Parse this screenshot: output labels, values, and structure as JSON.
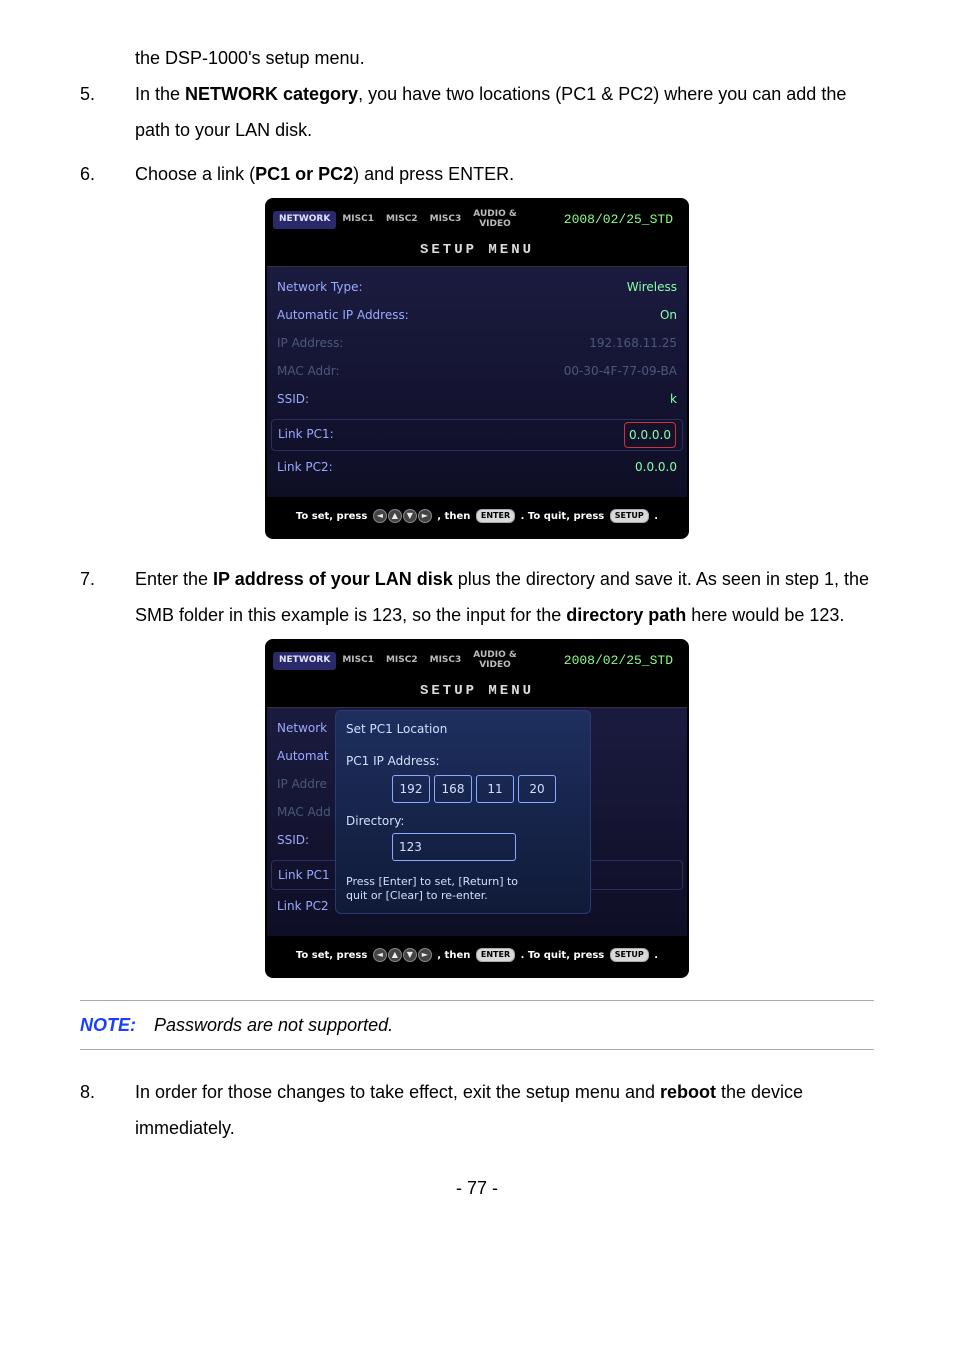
{
  "continuation_text_prefix": "the DSP-1000's setup menu.",
  "steps": {
    "s5": {
      "num": "5.",
      "pre": "In the ",
      "bold1": "NETWORK category",
      "mid": ", you have two locations (PC1 & PC2) where you can add the path to your LAN disk."
    },
    "s6": {
      "num": "6.",
      "pre": "Choose a link (",
      "bold1": "PC1 or PC2",
      "post": ") and press ENTER."
    },
    "s7": {
      "num": "7.",
      "pre": "Enter the ",
      "bold1": "IP address of your LAN disk",
      "mid": " plus the directory and save it. As seen in step 1, the SMB folder in this example is 123, so the input for the ",
      "bold2": "directory path",
      "post": " here would be 123."
    },
    "s8": {
      "num": "8.",
      "pre": "In order for those changes to take effect, exit the setup menu and ",
      "bold1": "reboot",
      "post": " the device immediately."
    }
  },
  "setup": {
    "tabs": [
      "NETWORK",
      "MISC1",
      "MISC2",
      "MISC3"
    ],
    "tab_av_line1": "AUDIO &",
    "tab_av_line2": "VIDEO",
    "date": "2008/02/25_STD",
    "title": "SETUP MENU",
    "rows": {
      "network_type": {
        "label": "Network Type:",
        "value": "Wireless"
      },
      "auto_ip": {
        "label": "Automatic IP Address:",
        "value": "On"
      },
      "ip": {
        "label": "IP Address:",
        "value": "192.168.11.25"
      },
      "mac": {
        "label": "MAC Addr:",
        "value": "00-30-4F-77-09-BA"
      },
      "ssid": {
        "label": "SSID:",
        "value": "k"
      },
      "pc1": {
        "label": "Link PC1:",
        "value": "0.0.0.0"
      },
      "pc2": {
        "label": "Link PC2:",
        "value": "0.0.0.0"
      }
    },
    "footer_pre": "To set, press",
    "footer_then": ", then",
    "footer_post": ". To quit, press",
    "footer_end": ".",
    "enter_btn": "ENTER",
    "setup_btn": "SETUP"
  },
  "setup2_left_labels": {
    "l1": "Network",
    "l2": "Automat",
    "l3": "IP Addre",
    "l4": "MAC Add",
    "l5": "SSID:",
    "l6": "Link PC1",
    "l7": "Link PC2"
  },
  "dialog": {
    "title": "Set PC1 Location",
    "ip_label": "PC1 IP Address:",
    "octets": [
      "192",
      "168",
      "11",
      "20"
    ],
    "dir_label": "Directory:",
    "dir_value": "123",
    "hint1": "Press [Enter] to set, [Return] to",
    "hint2": "quit or [Clear] to re-enter."
  },
  "note": {
    "label": "NOTE:",
    "text": "Passwords are not supported."
  },
  "page_number": "- 77 -"
}
